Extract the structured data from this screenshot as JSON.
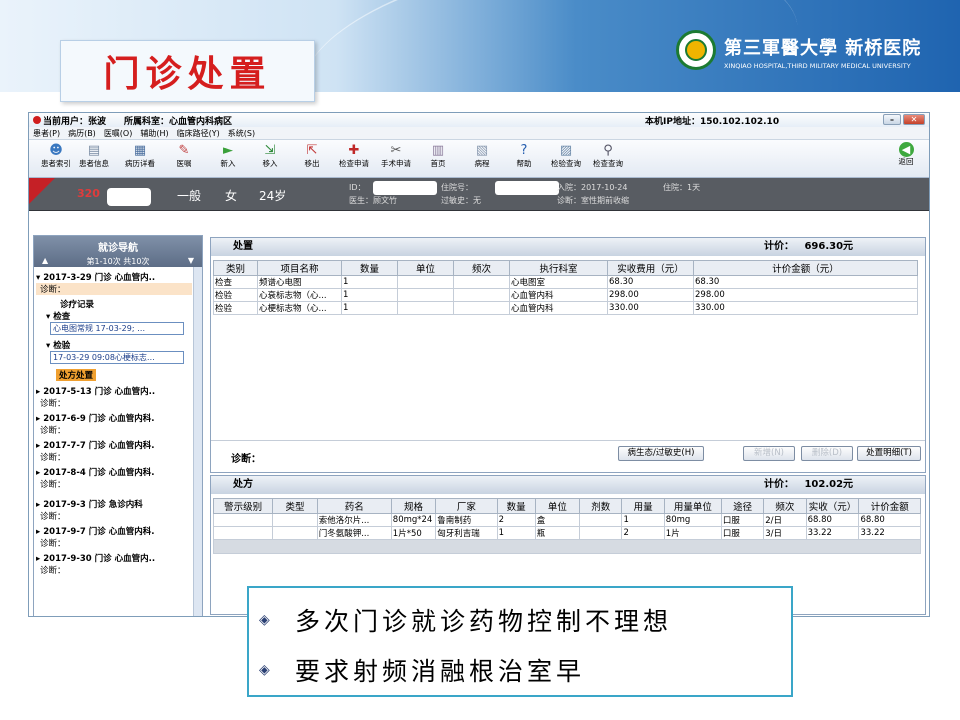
{
  "slide": {
    "title": "门诊处置",
    "hospital_cn": "第三軍醫大學 新桥医院",
    "hospital_en": "XINQIAO HOSPITAL,THIRD MILITARY MEDICAL UNIVERSITY",
    "bullets": [
      "多次门诊就诊药物控制不理想",
      "要求射频消融根治室早"
    ]
  },
  "app": {
    "top": {
      "current_user": "当前用户：张波",
      "department": "所属科室：心血管内科病区",
      "ip": "本机IP地址：150.102.102.10"
    },
    "menu": [
      "患者(P)",
      "病历(B)",
      "医嘱(O)",
      "辅助(H)",
      "临床路径(Y)",
      "系统(S)"
    ],
    "toolbar": [
      "患者索引",
      "患者信息",
      "病历详看",
      "医嘱",
      "新入",
      "移入",
      "移出",
      "检查申请",
      "手术申请",
      "首页",
      "病程",
      "帮助",
      "检验查询",
      "检查查询",
      "返回"
    ],
    "patient": {
      "id_num": "320",
      "level": "一般",
      "sex": "女",
      "age": "24岁",
      "id_label": "ID：",
      "doctor": "医生：顾文竹",
      "hosp_num": "住院号：",
      "allergy": "过敏史：无",
      "admit": "入院：2017-10-24",
      "stay": "住院：1天",
      "diagnosis": "诊断：室性期前收缩"
    },
    "nav": {
      "title": "就诊导航",
      "range": "第1-10次 共10次",
      "visits": [
        {
          "date": "2017-3-29 门诊 心血管内..",
          "diag": "诊断："
        },
        {
          "date": "2017-5-13 门诊 心血管内..",
          "diag": "诊断："
        },
        {
          "date": "2017-6-9 门诊 心血管内科.",
          "diag": "诊断："
        },
        {
          "date": "2017-7-7 门诊 心血管内科.",
          "diag": "诊断："
        },
        {
          "date": "2017-8-4 门诊 心血管内科.",
          "diag": "诊断："
        },
        {
          "date": "2017-9-3 门诊 急诊内科",
          "diag": "诊断："
        },
        {
          "date": "2017-9-7 门诊 心血管内科.",
          "diag": "诊断："
        },
        {
          "date": "2017-9-30 门诊 心血管内..",
          "diag": "诊断："
        }
      ],
      "record": "诊疗记录",
      "check_label": "检查",
      "check_item": "心电图常规 17-03-29; …",
      "test_label": "检验",
      "test_item": "17-03-29 09:08心梗标志…",
      "treat": "处方处置"
    },
    "disposal": {
      "title": "处置",
      "total_label": "计价：",
      "total": "696.30元",
      "headers": [
        "类别",
        "项目名称",
        "数量",
        "单位",
        "频次",
        "执行科室",
        "实收费用（元）",
        "计价金额（元）"
      ],
      "rows": [
        [
          "检查",
          "频谱心电图",
          "1",
          "",
          "",
          "心电图室",
          "68.30",
          "68.30"
        ],
        [
          "检验",
          "心衰标志物（心...",
          "1",
          "",
          "",
          "心血管内科",
          "298.00",
          "298.00"
        ],
        [
          "检验",
          "心梗标志物（心...",
          "1",
          "",
          "",
          "心血管内科",
          "330.00",
          "330.00"
        ]
      ]
    },
    "diag_label": "诊断：",
    "buttons": {
      "allergy": "病生态/过敏史(H)",
      "add": "新增(N)",
      "del": "删除(D)",
      "detail": "处置明细(T)"
    },
    "rx": {
      "title": "处方",
      "total_label": "计价：",
      "total": "102.02元",
      "headers": [
        "警示级别",
        "类型",
        "药名",
        "规格",
        "厂家",
        "数量",
        "单位",
        "剂数",
        "用量",
        "用量单位",
        "途径",
        "频次",
        "实收（元）",
        "计价金额"
      ],
      "rows": [
        [
          "",
          "",
          "索他洛尔片...",
          "80mg*24",
          "鲁南制药",
          "2",
          "盒",
          "",
          "1",
          "80mg",
          "口服",
          "2/日",
          "68.80",
          "68.80"
        ],
        [
          "",
          "",
          "门冬氨酸钾...",
          "1片*50",
          "匈牙利吉瑞",
          "1",
          "瓶",
          "",
          "2",
          "1片",
          "口服",
          "3/日",
          "33.22",
          "33.22"
        ]
      ]
    }
  },
  "colors": {
    "title_red": "#d51e1e",
    "banner_blue": "#1f64b0",
    "callout_border": "#3aa6c8"
  }
}
